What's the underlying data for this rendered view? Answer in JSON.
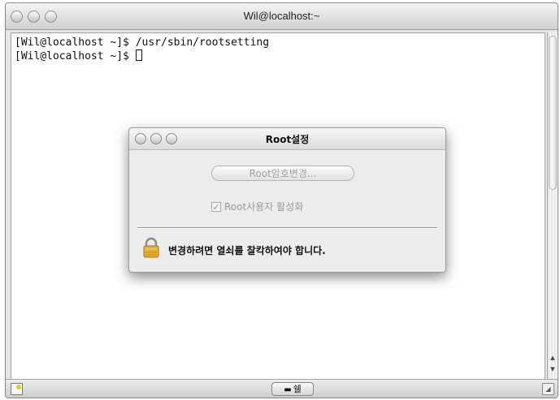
{
  "window": {
    "title": "Wil@localhost:~",
    "terminal_lines": [
      "[Wil@localhost ~]$ /usr/sbin/rootsetting",
      "[Wil@localhost ~]$ "
    ],
    "shell_tab_label": "쉘"
  },
  "dialog": {
    "title": "Root설정",
    "change_password_label": "Root암호변경...",
    "enable_root_label": "Root사용자 활성화",
    "enable_root_checked": true,
    "lock_message": "변경하려면 열쇠를 찰칵하여야 합니다."
  },
  "icons": {
    "lock": "lock-icon",
    "terminal": "terminal-icon"
  },
  "colors": {
    "lock_gold": "#e8b02c",
    "disabled_text": "#a2a2a2"
  }
}
